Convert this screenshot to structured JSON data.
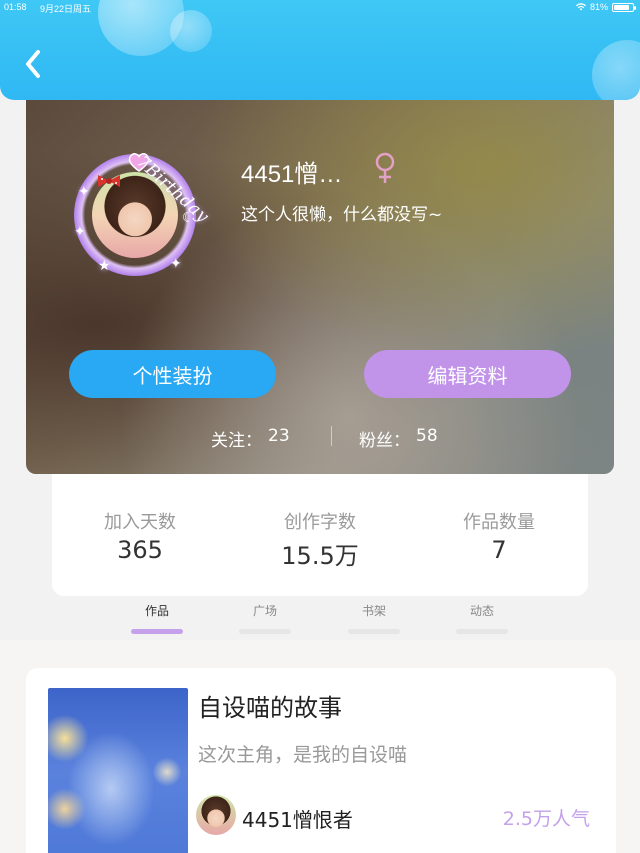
{
  "status_bar": {
    "time": "01:58",
    "date": "9月22日周五",
    "battery": "81%",
    "battery_level": 0.81
  },
  "header": {
    "back_icon": "chevron-left-icon"
  },
  "profile": {
    "frame_text": "7Birthday",
    "name": "4451憎…",
    "gender_icon": "female-icon",
    "gender_color": "#e5a0c8",
    "bio": "这个人很懒，什么都没写~",
    "buttons": {
      "dressup": "个性装扮",
      "edit": "编辑资料"
    },
    "follow": {
      "following_label": "关注：",
      "following_count": "23",
      "fans_label": "粉丝：",
      "fans_count": "58"
    }
  },
  "stats": [
    {
      "label": "加入天数",
      "value": "365"
    },
    {
      "label": "创作字数",
      "value": "15.5万"
    },
    {
      "label": "作品数量",
      "value": "7"
    }
  ],
  "tabs": [
    {
      "label": "作品",
      "active": true
    },
    {
      "label": "广场",
      "active": false
    },
    {
      "label": "书架",
      "active": false
    },
    {
      "label": "动态",
      "active": false
    }
  ],
  "works": [
    {
      "title": "自设喵的故事",
      "description": "这次主角，是我的自设喵",
      "author": "4451憎恨者",
      "popularity": "2.5万人气"
    }
  ],
  "colors": {
    "header": "#2fb8f3",
    "button_blue": "#29a8f3",
    "button_purple": "#c194ea",
    "accent_purple": "#c4a1ea"
  }
}
